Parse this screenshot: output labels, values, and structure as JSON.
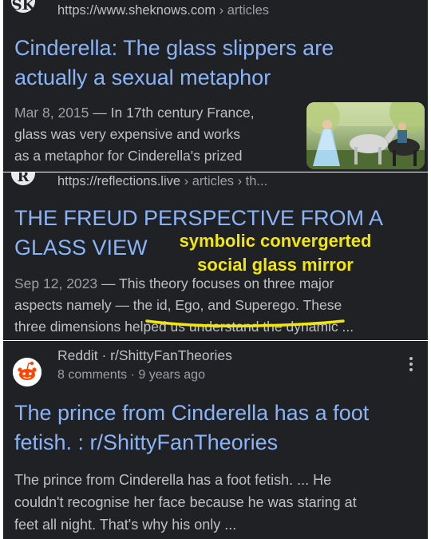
{
  "results": [
    {
      "favicon_icon": "sheknows-favicon-icon",
      "url_host": "https://www.sheknows.com",
      "url_path": " › articles",
      "title_line1": "Cinderella: The glass slippers are",
      "title_line2": "actually a sexual metaphor",
      "date": "Mar 8, 2015",
      "snippet_line1_rest": " — In 17th century France,",
      "snippet_line2": "glass was very expensive and works",
      "snippet_line3": "as a metaphor for Cinderella's prized",
      "thumbnail_icon": "cinderella-prince-horses-thumbnail"
    },
    {
      "favicon_icon": "reflections-favicon-icon",
      "url_host": "https://reflections.live",
      "url_path": " › articles › th...",
      "title_line1": "THE FREUD PERSPECTIVE FROM A",
      "title_line2": "GLASS VIEW",
      "date": "Sep 12, 2023",
      "snippet_line1_rest": " — This theory focuses on three major",
      "snippet_line2_a": "aspects namely — the id, Ego, and Superego.",
      "snippet_line2_b": " These",
      "snippet_line3": "three dimensions helped us understand the dynamic ..."
    },
    {
      "favicon_icon": "reddit-logo-icon",
      "source": "Reddit · r/ShittyFanTheories",
      "meta": "8 comments · 9 years ago",
      "title_line1": "The prince from Cinderella has a foot",
      "title_line2": "fetish. : r/ShittyFanTheories",
      "snippet_line1": "The prince from Cinderella has a foot fetish. ... He",
      "snippet_line2": "couldn't recognise her face because he was staring at",
      "snippet_line3": "feet all night. That's why his only ..."
    }
  ],
  "annotation": {
    "line1": "symbolic convergerted",
    "line2": "social glass mirror",
    "color": "#f2e60a"
  },
  "colors": {
    "background": "#202124",
    "link": "#8ab4f8",
    "text": "#bdc1c6",
    "muted": "#9aa0a6",
    "reddit": "#ff4500"
  }
}
